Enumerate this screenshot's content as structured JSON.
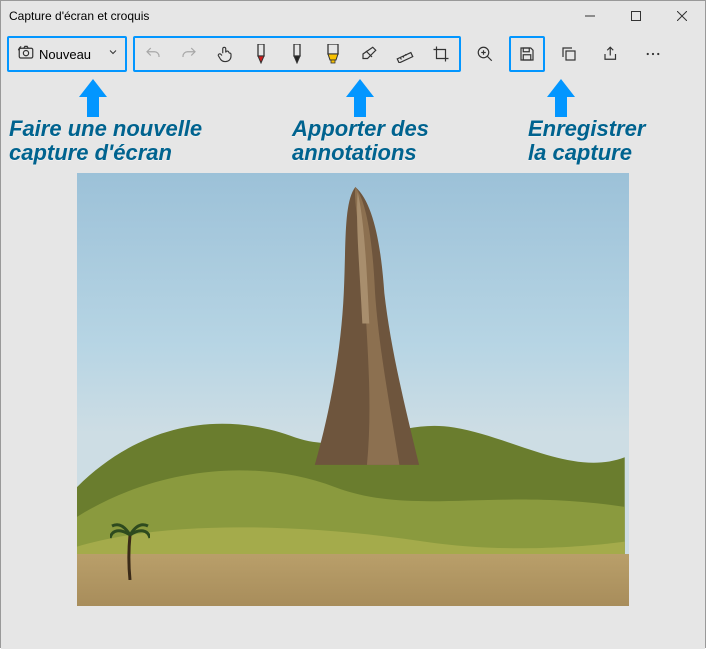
{
  "window": {
    "title": "Capture d'écran et croquis"
  },
  "toolbar": {
    "nouveau_label": "Nouveau",
    "icons": {
      "camera": "camera-icon",
      "chevron": "chevron-down-icon",
      "undo": "undo-icon",
      "redo": "redo-icon",
      "touch": "touch-writing-icon",
      "pen_red": "pen-icon",
      "pen_black": "pencil-icon",
      "highlighter": "highlighter-icon",
      "eraser": "eraser-icon",
      "ruler": "ruler-icon",
      "crop": "crop-icon",
      "zoom": "zoom-icon",
      "save": "save-icon",
      "copy": "copy-icon",
      "share": "share-icon",
      "more": "more-icon"
    }
  },
  "callouts": {
    "nouveau": "Faire une nouvelle\ncapture d'écran",
    "annot": "Apporter des\nannotations",
    "save": "Enregistrer\nla capture"
  },
  "colors": {
    "highlight": "#0296ff",
    "callout_text": "#00638f",
    "pen_red": "#d31a1a",
    "highlighter": "#f9c200"
  }
}
